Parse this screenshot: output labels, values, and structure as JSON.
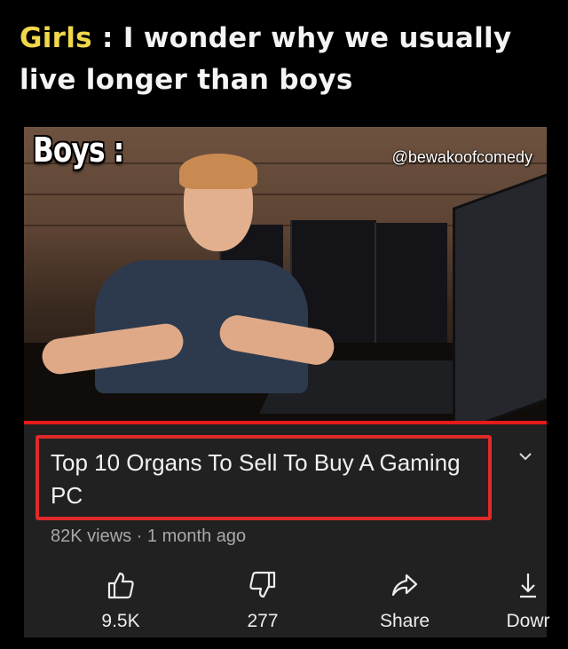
{
  "meme": {
    "caption_lead": "Girls",
    "caption_rest": " : I wonder why we usually live longer than boys",
    "overlay_label": "Boys :",
    "watermark": "@bewakoofcomedy"
  },
  "video": {
    "title": "Top 10 Organs To Sell To Buy A Gaming PC",
    "meta": "82K views · 1 month ago",
    "progress_fraction": 1.0,
    "highlight_color": "#e02a2a",
    "progress_color": "#e61a1a"
  },
  "actions": {
    "like": {
      "icon": "thumbs-up-icon",
      "label": "9.5K"
    },
    "dislike": {
      "icon": "thumbs-down-icon",
      "label": "277"
    },
    "share": {
      "icon": "share-arrow-icon",
      "label": "Share"
    },
    "download": {
      "icon": "download-icon",
      "label": "Dowr"
    }
  },
  "expand_icon": "chevron-down-icon"
}
